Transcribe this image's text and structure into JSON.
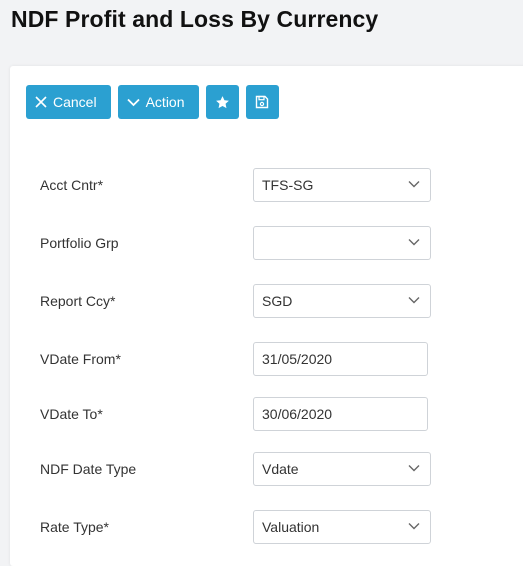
{
  "page": {
    "title": "NDF Profit and Loss By Currency"
  },
  "toolbar": {
    "cancel_label": "Cancel",
    "action_label": "Action",
    "favorite_icon": "star-icon",
    "save_icon": "floppy-disk-icon"
  },
  "colors": {
    "accent": "#2ba0d1",
    "background": "#f2f3f5",
    "card": "#ffffff",
    "field_border": "#cfd3d8"
  },
  "form": {
    "acct_cntr": {
      "label": "Acct Cntr*",
      "value": "TFS-SG"
    },
    "portfolio_grp": {
      "label": "Portfolio Grp",
      "value": ""
    },
    "report_ccy": {
      "label": "Report Ccy*",
      "value": "SGD"
    },
    "vdate_from": {
      "label": "VDate From*",
      "value": "31/05/2020"
    },
    "vdate_to": {
      "label": "VDate To*",
      "value": "30/06/2020"
    },
    "ndf_date_type": {
      "label": "NDF Date Type",
      "value": "Vdate"
    },
    "rate_type": {
      "label": "Rate Type*",
      "value": "Valuation"
    }
  }
}
